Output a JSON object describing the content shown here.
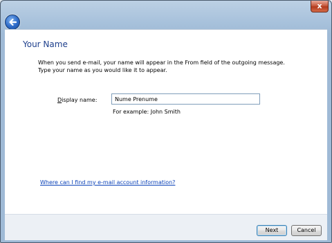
{
  "window": {
    "close_glyph": "x"
  },
  "page": {
    "title": "Your Name",
    "description_lines": [
      "When you send e-mail, your name will appear in the From field of the outgoing message.",
      "Type your name as you would like it to appear."
    ]
  },
  "form": {
    "display_name_label": "Display name:",
    "display_name_access_key": "D",
    "display_name_label_rest": "isplay name:",
    "display_name_value": "Nume Prenume",
    "example_text": "For example: John Smith"
  },
  "help_link": "Where can I find my e-mail account information?",
  "buttons": {
    "next": "Next",
    "cancel": "Cancel"
  },
  "icons": {
    "back": "back-arrow-icon",
    "close": "close-icon"
  },
  "colors": {
    "heading": "#1e3f8c",
    "link": "#0b42b8",
    "frame": "#a8c2dc"
  }
}
